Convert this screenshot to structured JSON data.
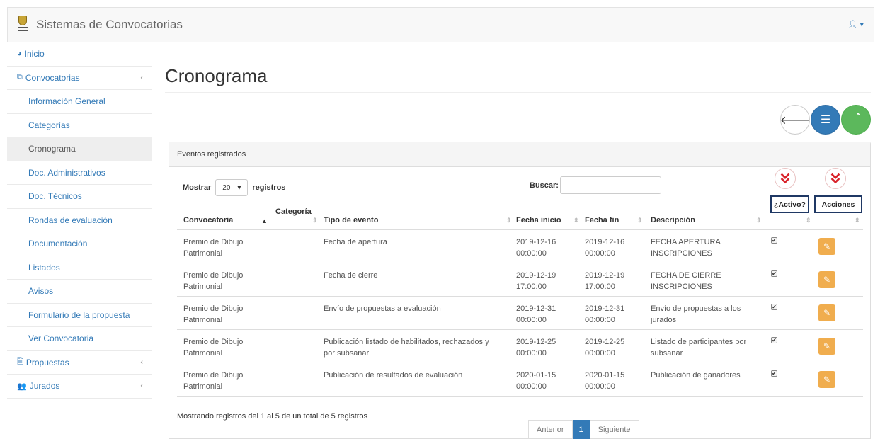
{
  "app": {
    "brand": "Sistemas de Convocatorias",
    "user_icon": "user-icon"
  },
  "sidebar": {
    "items": [
      {
        "label": "Inicio",
        "icon": "dashboard-icon",
        "level": "top"
      },
      {
        "label": "Convocatorias",
        "icon": "files-icon",
        "level": "top",
        "expandable": true
      },
      {
        "label": "Información General",
        "level": "sub"
      },
      {
        "label": "Categorías",
        "level": "sub"
      },
      {
        "label": "Cronograma",
        "level": "sub",
        "active": true
      },
      {
        "label": "Doc. Administrativos",
        "level": "sub"
      },
      {
        "label": "Doc. Técnicos",
        "level": "sub"
      },
      {
        "label": "Rondas de evaluación",
        "level": "sub"
      },
      {
        "label": "Documentación",
        "level": "sub"
      },
      {
        "label": "Listados",
        "level": "sub"
      },
      {
        "label": "Avisos",
        "level": "sub"
      },
      {
        "label": "Formulario de la propuesta",
        "level": "sub"
      },
      {
        "label": "Ver Convocatoria",
        "level": "sub"
      },
      {
        "label": "Propuestas",
        "icon": "file-icon",
        "level": "top",
        "expandable": true
      },
      {
        "label": "Jurados",
        "icon": "users-icon",
        "level": "top",
        "expandable": true
      }
    ]
  },
  "main": {
    "title": "Cronograma",
    "panel_title": "Eventos registrados",
    "length": {
      "prefix": "Mostrar",
      "value": "20",
      "suffix": "registros"
    },
    "search_label": "Buscar:",
    "annotations": [
      "¿Activo?",
      "Acciones"
    ],
    "columns": [
      "Convocatoria",
      "Categoría",
      "Tipo de evento",
      "Fecha inicio",
      "Fecha fin",
      "Descripción"
    ],
    "rows": [
      {
        "convocatoria": [
          "Premio de Dibujo",
          "Patrimonial"
        ],
        "tipo": [
          "Fecha de apertura"
        ],
        "inicio": [
          "2019-12-16",
          "00:00:00"
        ],
        "fin": [
          "2019-12-16",
          "00:00:00"
        ],
        "descripcion": [
          "FECHA APERTURA",
          "INSCRIPCIONES"
        ],
        "activo": true
      },
      {
        "convocatoria": [
          "Premio de Dibujo",
          "Patrimonial"
        ],
        "tipo": [
          "Fecha de cierre"
        ],
        "inicio": [
          "2019-12-19",
          "17:00:00"
        ],
        "fin": [
          "2019-12-19",
          "17:00:00"
        ],
        "descripcion": [
          "FECHA DE CIERRE",
          "INSCRIPCIONES"
        ],
        "activo": true
      },
      {
        "convocatoria": [
          "Premio de Dibujo",
          "Patrimonial"
        ],
        "tipo": [
          "Envío de propuestas a evaluación"
        ],
        "inicio": [
          "2019-12-31",
          "00:00:00"
        ],
        "fin": [
          "2019-12-31",
          "00:00:00"
        ],
        "descripcion": [
          "Envío de propuestas a los",
          "jurados"
        ],
        "activo": true
      },
      {
        "convocatoria": [
          "Premio de Dibujo",
          "Patrimonial"
        ],
        "tipo": [
          "Publicación listado de habilitados, rechazados y",
          "por subsanar"
        ],
        "inicio": [
          "2019-12-25",
          "00:00:00"
        ],
        "fin": [
          "2019-12-25",
          "00:00:00"
        ],
        "descripcion": [
          "Listado de participantes por",
          "subsanar"
        ],
        "activo": true
      },
      {
        "convocatoria": [
          "Premio de Dibujo",
          "Patrimonial"
        ],
        "tipo": [
          "Publicación de resultados de evaluación"
        ],
        "inicio": [
          "2020-01-15",
          "00:00:00"
        ],
        "fin": [
          "2020-01-15",
          "00:00:00"
        ],
        "descripcion": [
          "Publicación de ganadores"
        ],
        "activo": true
      }
    ],
    "info": "Mostrando registros del 1 al 5 de un total de 5 registros",
    "pager": {
      "prev": "Anterior",
      "current": "1",
      "next": "Siguiente"
    }
  },
  "colors": {
    "primary": "#337ab7",
    "success": "#5cb85c",
    "warning": "#f0ad4e",
    "annotation_red": "#d9222a",
    "annotation_box": "#1f3864"
  }
}
